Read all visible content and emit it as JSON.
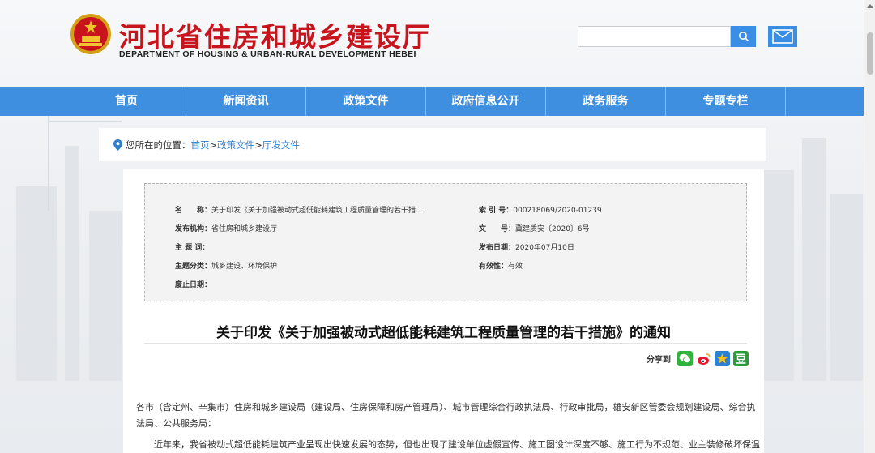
{
  "header": {
    "title": "河北省住房和城乡建设厅",
    "subtitle": "DEPARTMENT OF HOUSING & URBAN-RURAL DEVELOPMENT HEBEI",
    "search_placeholder": "",
    "search_icon": "search-icon",
    "mail_icon": "mail-icon"
  },
  "nav": {
    "items": [
      {
        "label": "首页"
      },
      {
        "label": "新闻资讯"
      },
      {
        "label": "政策文件"
      },
      {
        "label": "政府信息公开"
      },
      {
        "label": "政务服务"
      },
      {
        "label": "专题专栏"
      }
    ]
  },
  "breadcrumb": {
    "prefix": "您所在的位置：",
    "items": [
      "首页",
      "政策文件",
      "厅发文件"
    ],
    "separator": ">"
  },
  "meta": {
    "name_key": "名　　称：",
    "name_val": "关于印发《关于加强被动式超低能耗建筑工程质量管理的若干措...",
    "index_key": "索 引 号：",
    "index_val": "000218069/2020-01239",
    "issuer_key": "发布机构：",
    "issuer_val": "省住房和城乡建设厅",
    "docno_key": "文　　号：",
    "docno_val": "冀建质安〔2020〕6号",
    "subject_key": "主 题 词：",
    "subject_val": "",
    "date_key": "发布日期：",
    "date_val": "2020年07月10日",
    "category_key": "主题分类：",
    "category_val": "城乡建设、环境保护",
    "validity_key": "有效性：",
    "validity_val": "有效",
    "expiry_key": "废止日期：",
    "expiry_val": ""
  },
  "document": {
    "title": "关于印发《关于加强被动式超低能耗建筑工程质量管理的若干措施》的通知",
    "share_label": "分享到",
    "share_icons": [
      "wechat-icon",
      "weibo-icon",
      "qzone-icon",
      "douban-icon"
    ],
    "paragraph1": "各市（含定州、辛集市）住房和城乡建设局（建设局、住房保障和房产管理局）、城市管理综合行政执法局、行政审批局，雄安新区管委会规划建设局、综合执法局、公共服务局：",
    "paragraph2": "近年来，我省被动式超低能耗建筑产业呈现出快速发展的态势，但也出现了建设单位虚假宣传、施工图设计深度不够、施工行为不规范、业主装修破坏保温结构"
  },
  "colors": {
    "brand_red": "#c8141c",
    "nav_blue": "#3f8fe0",
    "link_blue": "#2f7fd1"
  }
}
